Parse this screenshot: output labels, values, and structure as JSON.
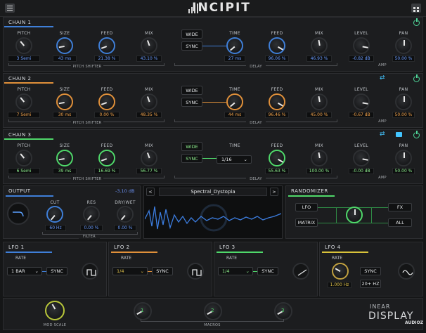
{
  "header": {
    "logo": "INCIPIT"
  },
  "colors": {
    "blue": "#3f7fd8",
    "orange": "#e0903a",
    "green": "#4fd86a",
    "yellow": "#d8c23a",
    "cyan": "#43c5ff",
    "teal": "#4fd89a"
  },
  "chains": [
    {
      "title": "CHAIN 1",
      "pitch_shifter": {
        "pitch_label": "PITCH",
        "pitch": "3 Semi",
        "size_label": "SIZE",
        "size": "43 ms",
        "feed_label": "FEED",
        "feed": "21.38 %",
        "mix_label": "MIX",
        "mix": "43.10 %",
        "group": "PITCH SHIFTER"
      },
      "delay": {
        "wide": "WIDE",
        "sync": "SYNC",
        "time_label": "TIME",
        "time": "27 ms",
        "feed_label": "FEED",
        "feed": "96.06 %",
        "mix_label": "MIX",
        "mix": "46.93 %",
        "group": "DELAY"
      },
      "amp": {
        "level_label": "LEVEL",
        "level": "-0.82 dB",
        "pan_label": "PAN",
        "pan": "50.00 %",
        "group": "AMP"
      }
    },
    {
      "title": "CHAIN 2",
      "pitch_shifter": {
        "pitch_label": "PITCH",
        "pitch": "7 Semi",
        "size_label": "SIZE",
        "size": "30 ms",
        "feed_label": "FEED",
        "feed": "0.00 %",
        "mix_label": "MIX",
        "mix": "48.35 %",
        "group": "PITCH SHIFTER"
      },
      "delay": {
        "wide": "WIDE",
        "sync": "SYNC",
        "time_label": "TIME",
        "time": "44 ms",
        "feed_label": "FEED",
        "feed": "96.46 %",
        "mix_label": "MIX",
        "mix": "45.00 %",
        "group": "DELAY"
      },
      "amp": {
        "level_label": "LEVEL",
        "level": "-0.67 dB",
        "pan_label": "PAN",
        "pan": "50.00 %",
        "group": "AMP"
      }
    },
    {
      "title": "CHAIN 3",
      "pitch_shifter": {
        "pitch_label": "PITCH",
        "pitch": "6 Semi",
        "size_label": "SIZE",
        "size": "39 ms",
        "feed_label": "FEED",
        "feed": "16.69 %",
        "mix_label": "MIX",
        "mix": "56.77 %",
        "group": "PITCH SHIFTER"
      },
      "delay": {
        "wide": "WIDE",
        "sync": "SYNC",
        "time_label": "TIME",
        "time": "1/16",
        "feed_label": "FEED",
        "feed": "55.63 %",
        "mix_label": "MIX",
        "mix": "100.00 %",
        "group": "DELAY"
      },
      "amp": {
        "level_label": "LEVEL",
        "level": "-0.00 dB",
        "pan_label": "PAN",
        "pan": "50.00 %",
        "group": "AMP"
      }
    }
  ],
  "output": {
    "title": "OUTPUT",
    "readout": "-3.10 dB",
    "cut_label": "CUT",
    "cut": "60 Hz",
    "res_label": "RES",
    "res": "0.00 %",
    "drywet_label": "DRY/WET",
    "drywet": "0.00 %",
    "group": "FILTER"
  },
  "preset": {
    "name": "Spectral_Dystopia",
    "prev": "<",
    "next": ">"
  },
  "randomizer": {
    "title": "RANDOMIZER",
    "lfo": "LFO",
    "matrix": "MATRIX",
    "fx": "FX",
    "all": "ALL"
  },
  "lfos": [
    {
      "title": "LFO 1",
      "rate_label": "RATE",
      "rate": "1 BAR",
      "sync": "SYNC"
    },
    {
      "title": "LFO 2",
      "rate_label": "RATE",
      "rate": "1/4",
      "sync": "SYNC"
    },
    {
      "title": "LFO 3",
      "rate_label": "RATE",
      "rate": "1/4",
      "sync": "SYNC"
    },
    {
      "title": "LFO 4",
      "rate_label": "RATE",
      "rate": "1.000 Hz",
      "sync": "SYNC",
      "sync2": "20+ HZ"
    }
  ],
  "footer": {
    "mod_scale": "MOD SCALE",
    "macros": "MACROS",
    "brand_top": "INEAR",
    "brand_bottom": "DISPLAY",
    "watermark": "AUDIOZ"
  }
}
